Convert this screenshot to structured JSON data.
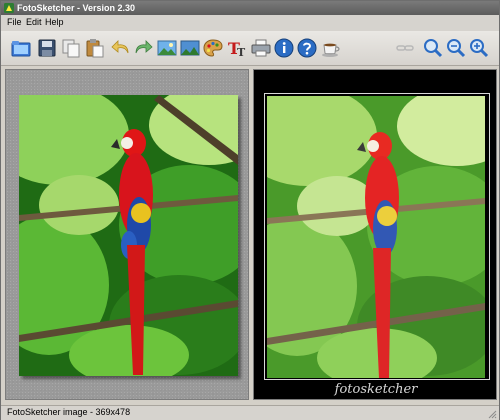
{
  "window": {
    "title": "FotoSketcher - Version 2.30"
  },
  "menu": [
    {
      "label": "File"
    },
    {
      "label": "Edit"
    },
    {
      "label": "Help"
    }
  ],
  "toolbar": [
    {
      "icon": "open-folder-icon"
    },
    {
      "icon": "save-icon"
    },
    {
      "icon": "copy-icon"
    },
    {
      "icon": "paste-icon"
    },
    {
      "icon": "undo-icon"
    },
    {
      "icon": "redo-icon"
    },
    {
      "icon": "image-landscape-icon"
    },
    {
      "icon": "image-landscape-alt-icon"
    },
    {
      "icon": "palette-icon"
    },
    {
      "icon": "text-tool-icon"
    },
    {
      "icon": "printer-icon"
    },
    {
      "icon": "info-icon"
    },
    {
      "icon": "help-icon"
    },
    {
      "icon": "coffee-cup-icon"
    },
    {
      "icon": "link-icon"
    },
    {
      "icon": "zoom-fit-icon"
    },
    {
      "icon": "zoom-actual-icon"
    },
    {
      "icon": "zoom-in-icon"
    }
  ],
  "preview": {
    "watermark": "fotosketcher"
  },
  "status": {
    "text": "FotoSketcher image - 369x478"
  },
  "colors": {
    "accent": "#2b6cc4",
    "parrot_red": "#d8141c",
    "foliage": "#3a8f1e"
  }
}
